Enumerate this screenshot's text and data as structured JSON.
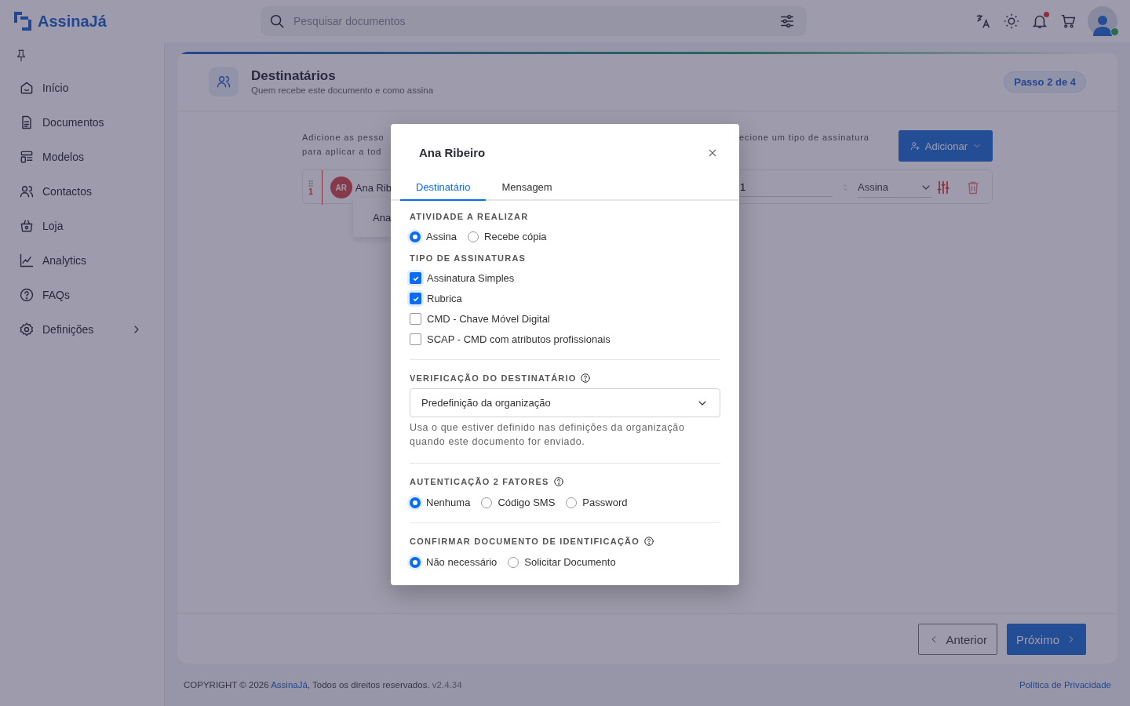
{
  "brand": {
    "name": "AssinaJá"
  },
  "search": {
    "placeholder": "Pesquisar documentos"
  },
  "sidebar": {
    "items": [
      {
        "label": "Início",
        "kind": "home",
        "submenu": false
      },
      {
        "label": "Documentos",
        "kind": "document",
        "submenu": false
      },
      {
        "label": "Modelos",
        "kind": "template",
        "submenu": false
      },
      {
        "label": "Contactos",
        "kind": "contacts",
        "submenu": false
      },
      {
        "label": "Loja",
        "kind": "shop",
        "submenu": false
      },
      {
        "label": "Analytics",
        "kind": "chart",
        "submenu": false
      },
      {
        "label": "FAQs",
        "kind": "help",
        "submenu": false
      },
      {
        "label": "Definições",
        "kind": "settings",
        "submenu": true
      }
    ]
  },
  "step": {
    "title": "Destinatários",
    "subtitle": "Quem recebe este documento e como assina",
    "badge": "Passo 2 de 4"
  },
  "instructions": {
    "left_lines": [
      "Adicione as pesso",
      "para aplicar a tod"
    ],
    "right_fragment": "ecione um tipo de assinatura"
  },
  "add_button": {
    "label": "Adicionar"
  },
  "recipient_row": {
    "order": "1",
    "initials": "AR",
    "name_fragment": "Ana Rib",
    "order_value": "1",
    "role": "Assina"
  },
  "suggestion": {
    "label": "Ana"
  },
  "nav": {
    "previous": "Anterior",
    "next": "Próximo"
  },
  "footer": {
    "copyright_before": "COPYRIGHT © 2026 ",
    "brand_link": "AssinaJá",
    "copyright_after": ", Todos os direitos reservados.",
    "version": "v2.4.34",
    "privacy": "Política de Privacidade"
  },
  "dialog": {
    "title": "Ana Ribeiro",
    "tabs": [
      {
        "label": "Destinatário",
        "selected": true
      },
      {
        "label": "Mensagem",
        "selected": false
      }
    ],
    "sections": [
      {
        "kind": "radio",
        "title": "ATIVIDADE A REALIZAR",
        "help": false,
        "divider": false,
        "options": [
          {
            "label": "Assina",
            "selected": true
          },
          {
            "label": "Recebe cópia",
            "selected": false
          }
        ]
      },
      {
        "kind": "checkbox",
        "title": "TIPO DE ASSINATURAS",
        "help": false,
        "divider": false,
        "options": [
          {
            "label": "Assinatura Simples",
            "checked": true
          },
          {
            "label": "Rubrica",
            "checked": true
          },
          {
            "label": "CMD - Chave Móvel Digital",
            "checked": false
          },
          {
            "label": "SCAP - CMD com atributos profissionais",
            "checked": false
          }
        ]
      },
      {
        "kind": "select",
        "title": "VERIFICAÇÃO DO DESTINATÁRIO",
        "help": true,
        "divider": true,
        "value": "Predefinição da organização",
        "hint": "Usa o que estiver definido nas definições da organização quando este documento for enviado."
      },
      {
        "kind": "radio",
        "title": "AUTENTICAÇÃO 2 FATORES",
        "help": true,
        "divider": true,
        "options": [
          {
            "label": "Nenhuma",
            "selected": true
          },
          {
            "label": "Código SMS",
            "selected": false
          },
          {
            "label": "Password",
            "selected": false
          }
        ]
      },
      {
        "kind": "radio",
        "title": "CONFIRMAR DOCUMENTO DE IDENTIFICAÇÃO",
        "help": true,
        "divider": true,
        "options": [
          {
            "label": "Não necessário",
            "selected": true
          },
          {
            "label": "Solicitar Documento",
            "selected": false
          }
        ]
      }
    ]
  }
}
